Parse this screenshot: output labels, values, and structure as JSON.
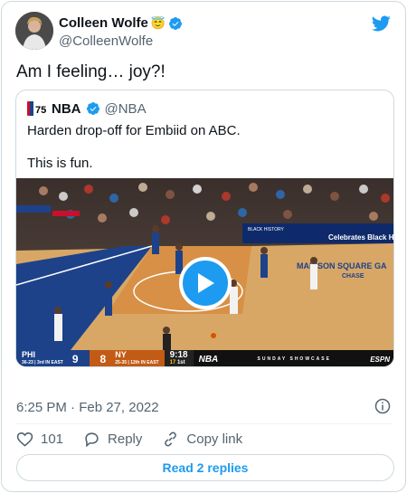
{
  "tweet": {
    "author_name": "Colleen Wolfe",
    "author_emoji": "😇",
    "author_handle": "@ColleenWolfe",
    "text": "Am I feeling… joy?!",
    "timestamp": "6:25 PM · Feb 27, 2022",
    "likes": "101",
    "reply_label": "Reply",
    "copy_link_label": "Copy link",
    "read_replies_label": "Read 2 replies"
  },
  "quote": {
    "author_name": "NBA",
    "author_handle": "@NBA",
    "text_line1": "Harden drop-off for Embiid on ABC.",
    "text_line2": "This is fun."
  },
  "video": {
    "scorebug": {
      "home_team": "PHI",
      "home_record": "36-23 | 3rd IN EAST",
      "home_score": "9",
      "away_score": "8",
      "away_team": "NY",
      "away_record": "25-35 | 12th IN EAST",
      "game_clock": "9:18",
      "quarter": "1st",
      "shot_clock": "17",
      "network": "NBA",
      "showcase": "SUNDAY SHOWCASE",
      "broadcaster": "ESPN"
    },
    "arena_text": {
      "banner1": "BLACK HISTORY",
      "banner2": "Celebrates Black H",
      "court": "MADISON SQUARE GA",
      "court2": "CHASE"
    }
  },
  "colors": {
    "accent": "#1d9bf0",
    "text": "#0f1419",
    "secondary": "#536471",
    "border": "#cfd9de"
  }
}
